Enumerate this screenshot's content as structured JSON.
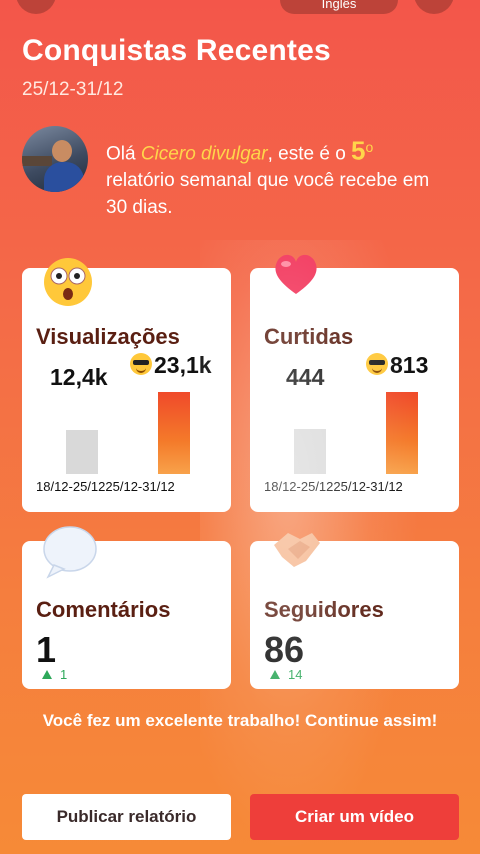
{
  "top_bar": {
    "language_label": "Inglês"
  },
  "header": {
    "title": "Conquistas Recentes",
    "date_range": "25/12-31/12"
  },
  "greeting": {
    "prefix": "Olá ",
    "name": "Cicero divulgar",
    "middle": ", este é o ",
    "number": "5",
    "ordinal": "o",
    "suffix": "relatório semanal que você recebe em 30 dias."
  },
  "cards": {
    "views": {
      "label": "Visualizações",
      "prev_value": "12,4k",
      "cur_value": "23,1k",
      "prev_ratio": 0.537,
      "cur_ratio": 1.0,
      "dates": "18/12-25/1225/12-31/12"
    },
    "likes": {
      "label": "Curtidas",
      "prev_value": "444",
      "cur_value": "813",
      "prev_ratio": 0.546,
      "cur_ratio": 1.0,
      "dates": "18/12-25/1225/12-31/12"
    },
    "comments": {
      "label": "Comentários",
      "value": "1",
      "delta": "1"
    },
    "followers": {
      "label": "Seguidores",
      "value": "86",
      "delta": "14"
    }
  },
  "message": "Você fez um excelente trabalho! Continue assim!",
  "buttons": {
    "publish": "Publicar relatório",
    "video": "Criar um vídeo"
  },
  "colors": {
    "background_top": "#f3564a",
    "background_bottom": "#f68a37",
    "highlight": "#ffd54a",
    "bar_current": "#f04a2a",
    "bar_previous": "#d9d9d9",
    "delta_up": "#2ea85a",
    "video_button": "#ee3e3a"
  }
}
